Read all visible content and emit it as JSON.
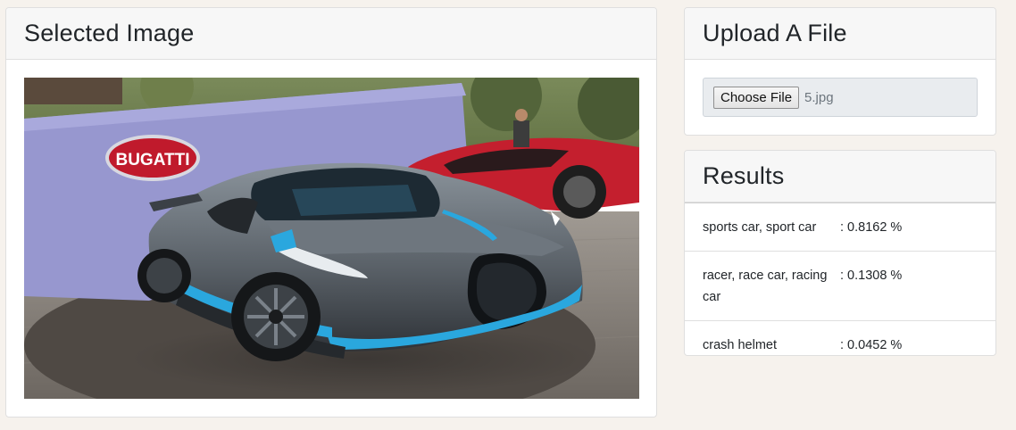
{
  "image_card": {
    "title": "Selected Image"
  },
  "upload_card": {
    "title": "Upload A File",
    "choose_button": "Choose File",
    "file_name": "5.jpg"
  },
  "results_card": {
    "title": "Results",
    "rows": [
      {
        "label": "sports car, sport car",
        "value": ": 0.8162 %"
      },
      {
        "label": "racer, race car, racing car",
        "value": ": 0.1308 %"
      },
      {
        "label": "crash helmet",
        "value": ": 0.0452 %"
      }
    ]
  },
  "photo": {
    "logo_text": "BUGATTI"
  },
  "colors": {
    "page_bg": "#f6f2ed",
    "card_header_bg": "#f7f7f7",
    "file_input_bg": "#e9ecef",
    "car_body": "#5f6770",
    "car_accent": "#2aa7de",
    "red_car": "#c41f2e",
    "backdrop": "#8f8fcc"
  }
}
